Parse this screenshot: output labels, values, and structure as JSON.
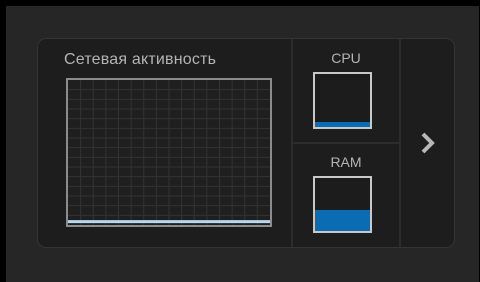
{
  "widget": {
    "network": {
      "title": "Сетевая активность",
      "activity_level": 0.01,
      "line_color": "#b8d8f0",
      "grid_color": "#333333"
    },
    "cpu": {
      "label": "CPU",
      "usage_fraction": 0.09,
      "fill_color": "#0a6cb3"
    },
    "ram": {
      "label": "RAM",
      "usage_fraction": 0.4,
      "fill_color": "#0a6cb3"
    },
    "next_icon": "chevron-right-icon"
  }
}
